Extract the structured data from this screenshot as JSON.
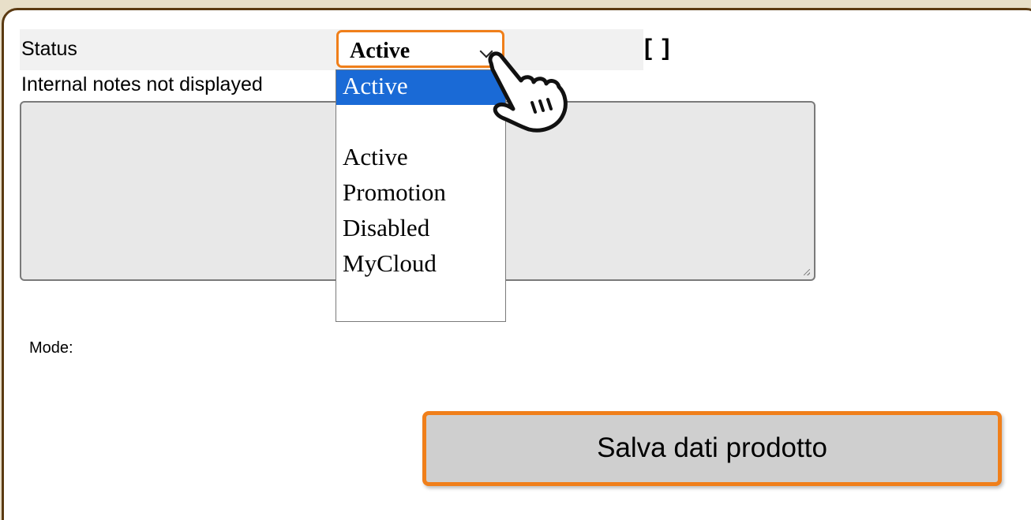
{
  "form": {
    "status_label": "Status",
    "status_selected": "Active",
    "brackets_text": "[ ]",
    "notes_label": "Internal notes not displayed",
    "notes_value": "",
    "mode_label": "Mode:"
  },
  "dropdown": {
    "options": [
      "Active",
      "",
      "Active",
      "Promotion",
      "Disabled",
      "MyCloud",
      ""
    ],
    "highlighted_index": 0
  },
  "actions": {
    "save_label": "Salva dati prodotto"
  },
  "colors": {
    "accent_orange": "#f07f1a",
    "highlight_blue": "#1a6ad6",
    "frame_brown": "#5b3a12",
    "background_tan": "#e8dfc9"
  },
  "icons": {
    "pointer": "hand-pointer-icon",
    "select": "chevron-down-icon"
  }
}
